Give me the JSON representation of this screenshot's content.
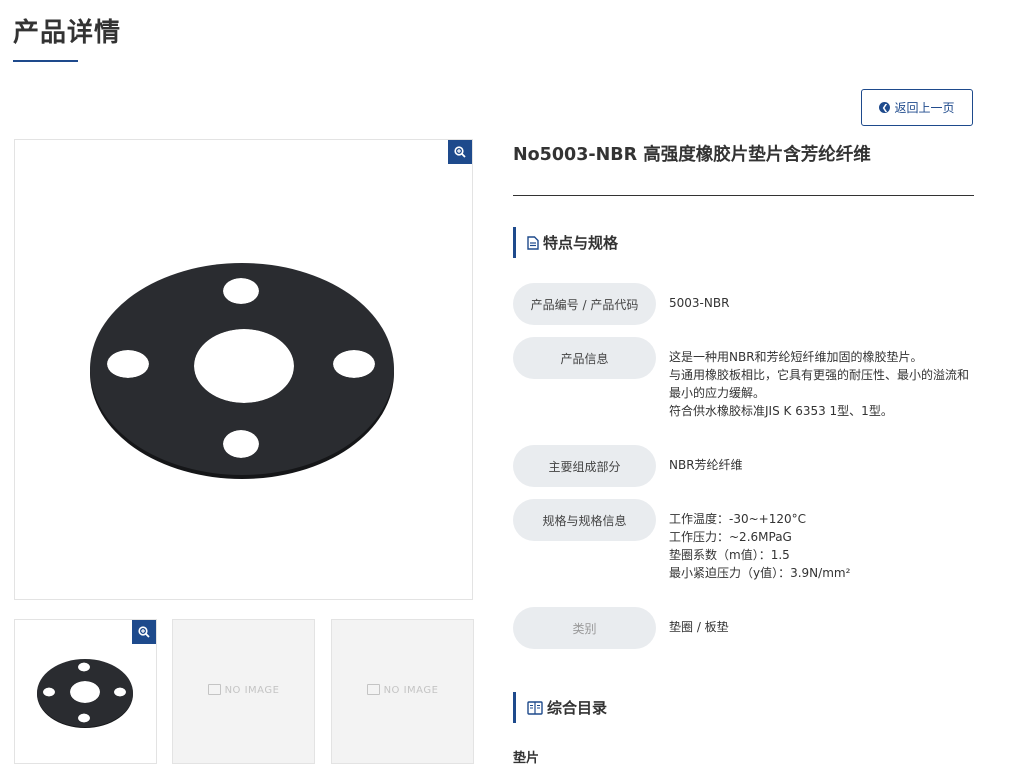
{
  "page": {
    "title": "产品详情"
  },
  "back_button": {
    "label": "返回上一页"
  },
  "gallery": {
    "no_image_text": "NO IMAGE"
  },
  "product": {
    "title": "No5003-NBR 高强度橡胶片垫片含芳纶纤维"
  },
  "specs_section": {
    "heading": "特点与规格"
  },
  "specs": {
    "code": {
      "label": "产品编号 / 产品代码",
      "value": "5003-NBR"
    },
    "info": {
      "label": "产品信息",
      "lines": [
        "这是一种用NBR和芳纶短纤维加固的橡胶垫片。",
        "与通用橡胶板相比，它具有更强的耐压性、最小的溢流和",
        "最小的应力缓解。",
        "符合供水橡胶标准JIS K 6353 1型、1型。"
      ]
    },
    "material": {
      "label": "主要组成部分",
      "value": "NBR芳纶纤维"
    },
    "spec": {
      "label": "规格与规格信息",
      "lines": [
        "工作温度：-30~+120°C",
        "工作压力：~2.6MPaG",
        "垫圈系数（m值）：1.5",
        "最小紧迫压力（y值）：3.9N/mm²"
      ]
    },
    "category": {
      "label": "类别",
      "value": "垫圈 / 板垫"
    }
  },
  "catalog_section": {
    "heading": "综合目录"
  },
  "catalog": {
    "first_item": "垫片"
  },
  "colors": {
    "accent": "#1e4a8c",
    "label_bg": "#e9ecef",
    "gasket": "#26282c"
  }
}
